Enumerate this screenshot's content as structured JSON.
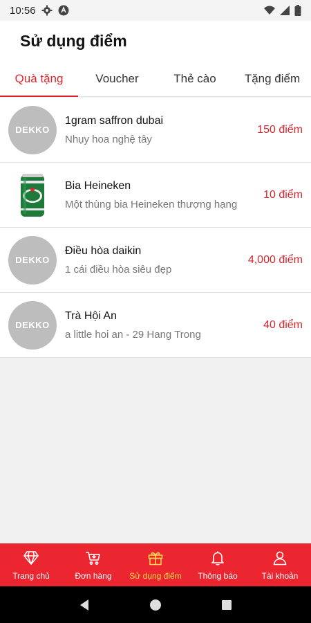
{
  "status_bar": {
    "time": "10:56"
  },
  "header": {
    "title": "Sử dụng điểm"
  },
  "tabs": [
    {
      "label": "Quà tặng",
      "active": true
    },
    {
      "label": "Voucher",
      "active": false
    },
    {
      "label": "Thẻ cào",
      "active": false
    },
    {
      "label": "Tặng điểm",
      "active": false
    }
  ],
  "items": [
    {
      "thumb": "DEKKO",
      "name": "1gram saffron dubai",
      "desc": "Nhụy hoa nghệ tây",
      "points": "150 điểm"
    },
    {
      "thumb": "heineken-can-image",
      "name": "Bia Heineken",
      "desc": "Một thùng bia Heineken thượng hạng",
      "points": "10 điểm"
    },
    {
      "thumb": "DEKKO",
      "name": "Điều hòa daikin",
      "desc": "1 cái điều hòa siêu đẹp",
      "points": "4,000 điểm"
    },
    {
      "thumb": "DEKKO",
      "name": "Trà Hội An",
      "desc": "a little hoi an - 29 Hang Trong",
      "points": "40 điểm"
    }
  ],
  "bottom_nav": [
    {
      "label": "Trang chủ",
      "icon": "diamond-icon",
      "active": false
    },
    {
      "label": "Đơn hàng",
      "icon": "cart-icon",
      "active": false
    },
    {
      "label": "Sử dụng điểm",
      "icon": "gift-icon",
      "active": true
    },
    {
      "label": "Thông báo",
      "icon": "bell-icon",
      "active": false
    },
    {
      "label": "Tài khoản",
      "icon": "user-icon",
      "active": false
    }
  ],
  "colors": {
    "brand_red": "#ec2631",
    "active_yellow": "#ffd94a",
    "points_red": "#d7262e"
  }
}
